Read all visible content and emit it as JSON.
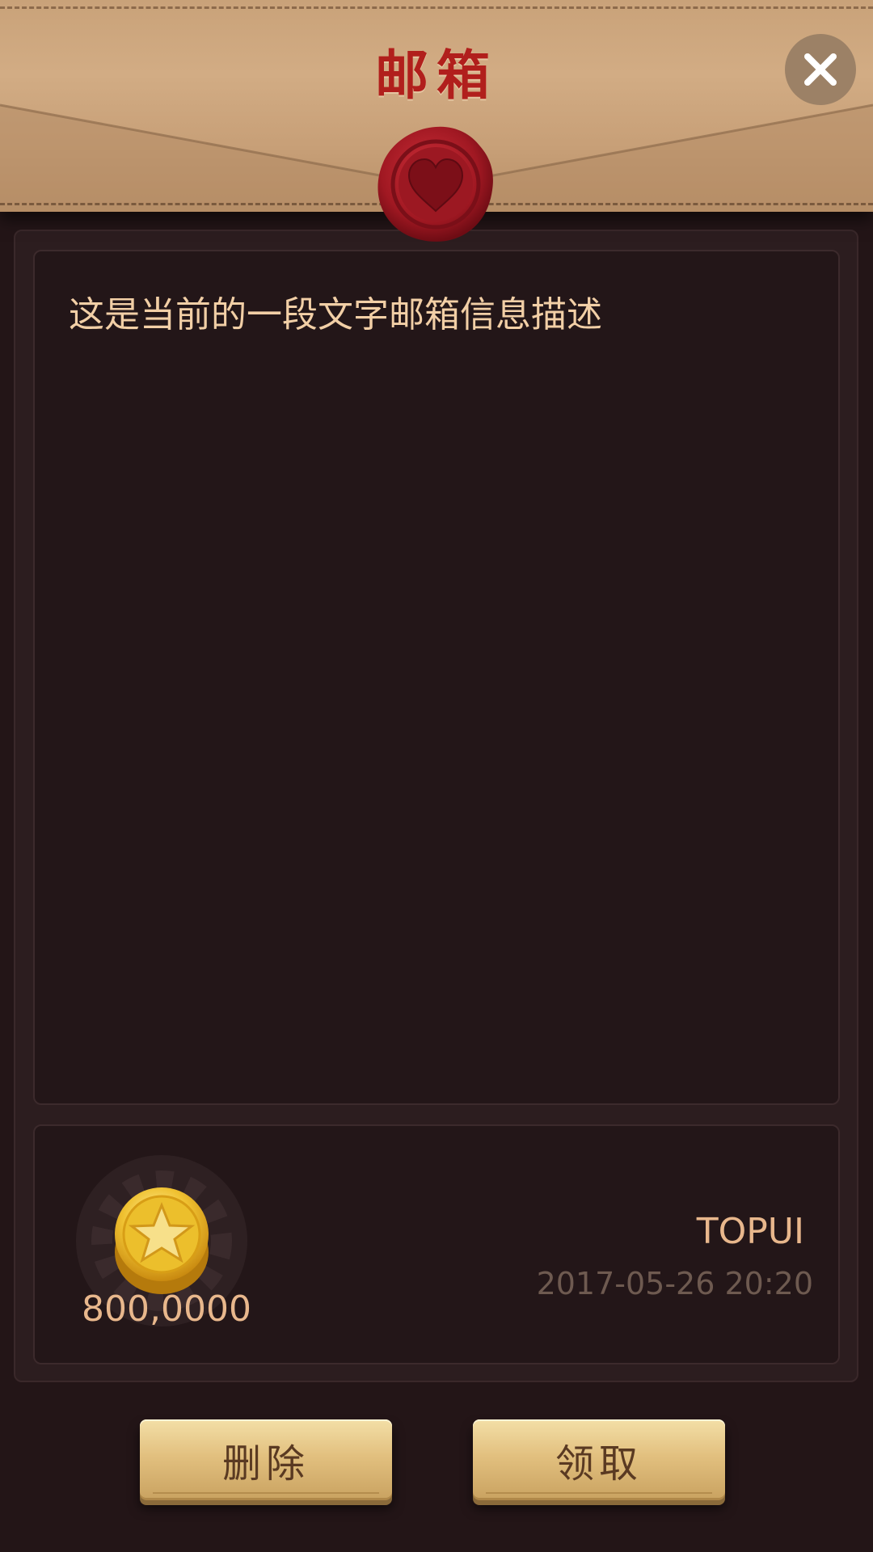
{
  "header": {
    "title": "邮箱",
    "close_icon": "close-icon",
    "seal_icon": "heart-wax-seal-icon"
  },
  "message": {
    "text": "这是当前的一段文字邮箱信息描述"
  },
  "reward": {
    "icon": "gold-coin-star-icon",
    "amount": "800,0000"
  },
  "meta": {
    "sender": "TOPUI",
    "datetime": "2017-05-26 20:20"
  },
  "actions": {
    "delete_label": "删除",
    "claim_label": "领取"
  },
  "colors": {
    "background": "#231517",
    "envelope": "#d2ac84",
    "title": "#b11f1c",
    "seal": "#a8161f",
    "text_light": "#f2cfa6",
    "text_muted": "#6e5a50",
    "button_gold": "#e2c07f"
  }
}
